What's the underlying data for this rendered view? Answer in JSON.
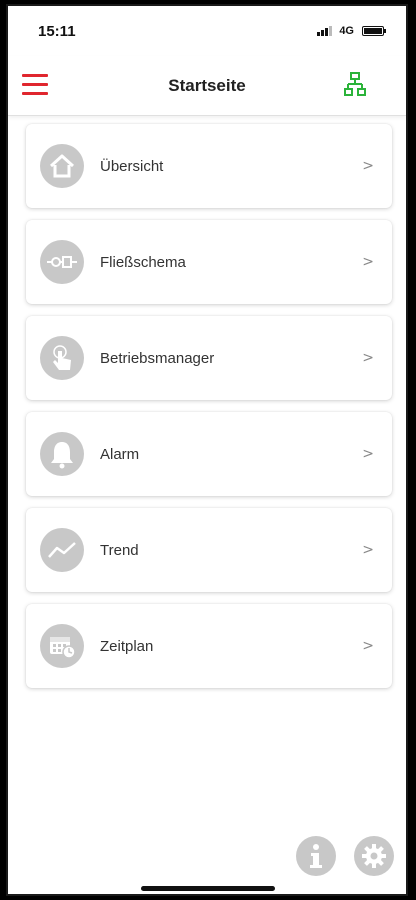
{
  "status": {
    "time": "15:11",
    "network": "4G"
  },
  "header": {
    "title": "Startseite"
  },
  "colors": {
    "accent": "#e0262e",
    "network": "#2bb33a",
    "icon_bg": "#c8c8c8"
  },
  "menu": {
    "items": [
      {
        "label": "Übersicht",
        "icon": "home-icon"
      },
      {
        "label": "Fließschema",
        "icon": "flow-diagram-icon"
      },
      {
        "label": "Betriebsmanager",
        "icon": "hand-pointer-icon"
      },
      {
        "label": "Alarm",
        "icon": "bell-icon"
      },
      {
        "label": "Trend",
        "icon": "trend-line-icon"
      },
      {
        "label": "Zeitplan",
        "icon": "calendar-clock-icon"
      }
    ],
    "chevron": ">"
  }
}
